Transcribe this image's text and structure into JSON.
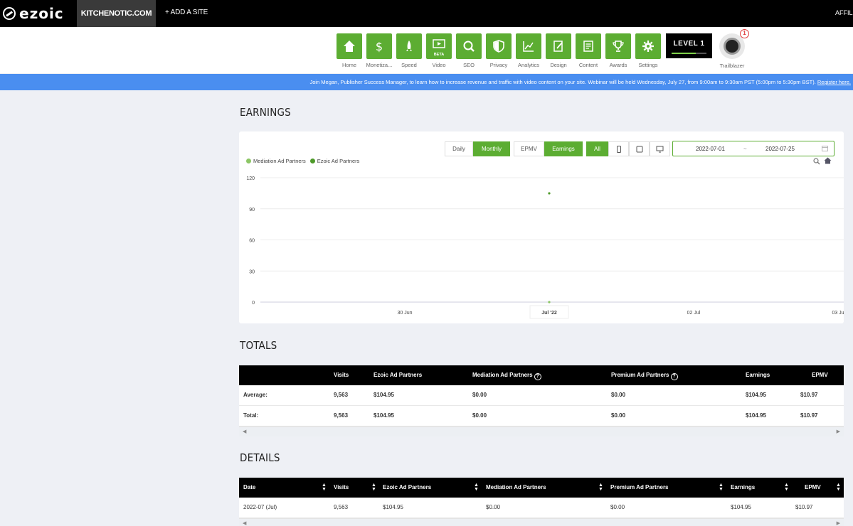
{
  "topbar": {
    "logo": "ezoic",
    "site": "KITCHENOTIC.COM",
    "add_site": "+ ADD A SITE",
    "affiliate": "AFFILIA"
  },
  "nav": {
    "items": [
      {
        "label": "Home",
        "icon": "home-icon"
      },
      {
        "label": "Monetiza...",
        "icon": "dollar-icon"
      },
      {
        "label": "Speed",
        "icon": "rocket-icon"
      },
      {
        "label": "Video",
        "icon": "video-icon",
        "badge": "BETA"
      },
      {
        "label": "SEO",
        "icon": "magnifier-icon"
      },
      {
        "label": "Privacy",
        "icon": "shield-icon"
      },
      {
        "label": "Analytics",
        "icon": "chart-icon"
      },
      {
        "label": "Design",
        "icon": "design-icon"
      },
      {
        "label": "Content",
        "icon": "document-icon"
      },
      {
        "label": "Awards",
        "icon": "trophy-icon"
      },
      {
        "label": "Settings",
        "icon": "gear-icon"
      }
    ],
    "level": "LEVEL 1",
    "trailblazer": "Trailblazer",
    "notification_count": "1"
  },
  "announcement": {
    "text": "Join Megan, Publisher Success Manager, to learn how to increase revenue and traffic with video content on your site. Webinar will be held Wednesday, July 27, from 9:00am to 9:30am PST (5:00pm to 5:30pm BST).",
    "link": "Register here."
  },
  "earnings": {
    "title": "EARNINGS",
    "period_buttons": [
      "Daily",
      "Monthly"
    ],
    "metric_buttons": [
      "EPMV",
      "Earnings"
    ],
    "device_all": "All",
    "date_from": "2022-07-01",
    "date_sep": "~",
    "date_to": "2022-07-25"
  },
  "chart_data": {
    "type": "scatter",
    "legend": [
      "Mediation Ad Partners",
      "Ezoic Ad Partners"
    ],
    "colors": {
      "Mediation Ad Partners": "#8cc665",
      "Ezoic Ad Partners": "#4e9a2a"
    },
    "y_ticks": [
      "120",
      "90",
      "60",
      "30",
      "0"
    ],
    "ylim": [
      0,
      120
    ],
    "x_ticks": [
      "30 Jun",
      "Jul '22",
      "02 Jul",
      "03 Ju"
    ],
    "series": [
      {
        "name": "Mediation Ad Partners",
        "points": [
          {
            "x": "Jul '22",
            "y": 0
          }
        ]
      },
      {
        "name": "Ezoic Ad Partners",
        "points": [
          {
            "x": "Jul '22",
            "y": 104.95
          }
        ]
      }
    ],
    "legend_position": "top-left",
    "grid": true
  },
  "totals": {
    "title": "TOTALS",
    "columns": [
      "",
      "Visits",
      "Ezoic Ad Partners",
      "Mediation Ad Partners",
      "Premium Ad Partners",
      "Earnings",
      "EPMV"
    ],
    "rows": [
      [
        "Average:",
        "9,563",
        "$104.95",
        "$0.00",
        "$0.00",
        "$104.95",
        "$10.97"
      ],
      [
        "Total:",
        "9,563",
        "$104.95",
        "$0.00",
        "$0.00",
        "$104.95",
        "$10.97"
      ]
    ]
  },
  "details": {
    "title": "DETAILS",
    "columns": [
      "Date",
      "Visits",
      "Ezoic Ad Partners",
      "Mediation Ad Partners",
      "Premium Ad Partners",
      "Earnings",
      "EPMV"
    ],
    "rows": [
      [
        "2022-07 (Jul)",
        "9,563",
        "$104.95",
        "$0.00",
        "$0.00",
        "$104.95",
        "$10.97"
      ]
    ]
  }
}
